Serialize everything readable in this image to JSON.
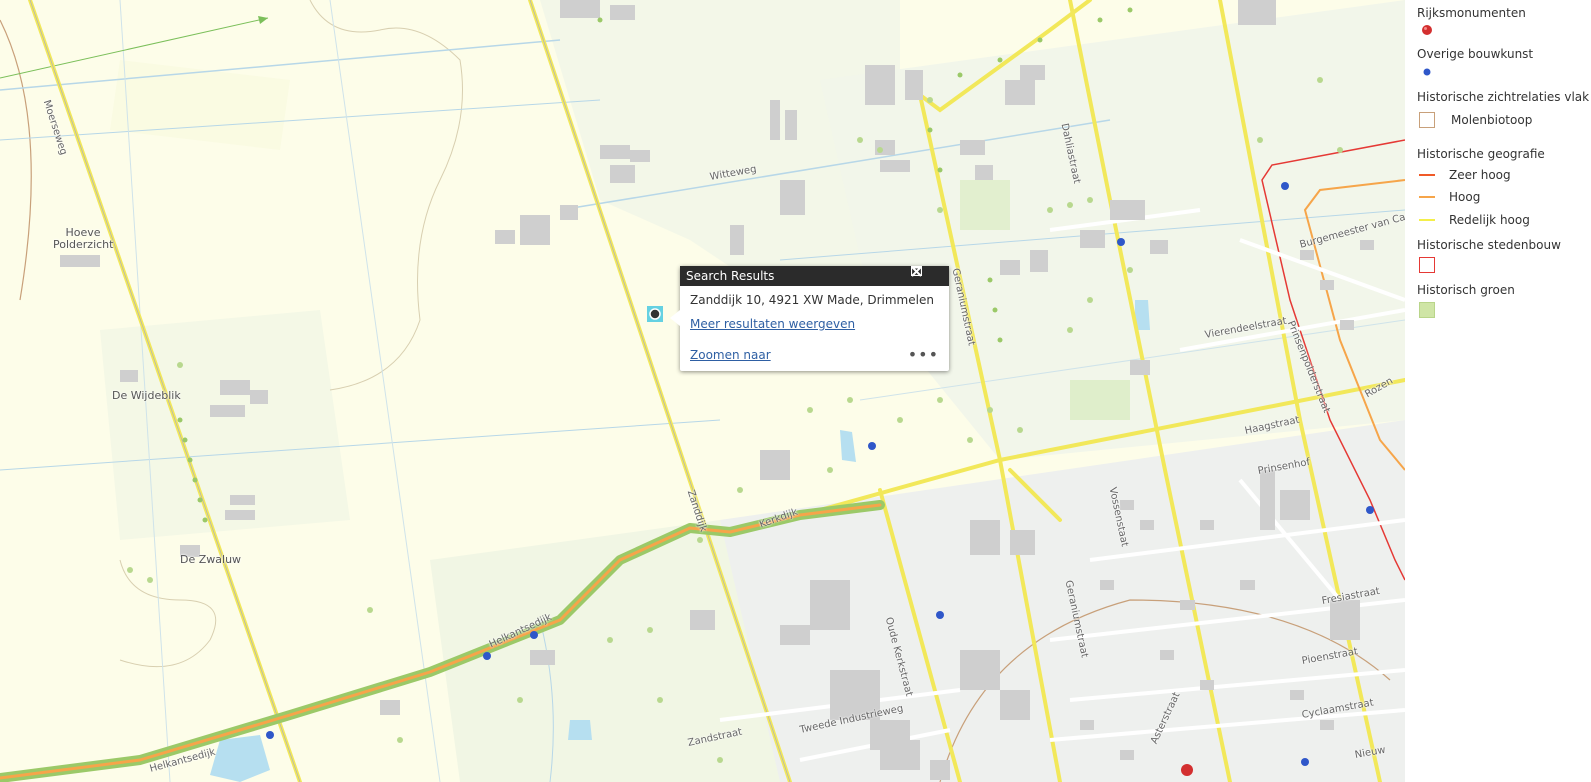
{
  "map": {
    "place_labels": [
      "Hoeve\nPolderzicht",
      "De Wijdeblik",
      "De Zwaluw"
    ],
    "street_labels": [
      "Moerseweg",
      "Witteweg",
      "Dahliastraat",
      "Geraniumstraat",
      "Burgemeester van Ca",
      "Prinsenpolderstraat",
      "Vierendeelstraat",
      "Rozen",
      "Haagstraat",
      "Prinsenhof",
      "Vossenstaat",
      "Geraniumstraat",
      "Fresiastraat",
      "Pioenstraat",
      "Cyclaamstraat",
      "Asterstraat",
      "Nieuw",
      "Zanddijk",
      "Kerkdijk",
      "Helkantsedijk",
      "Helkantsedijk",
      "Oude Kerkstraat",
      "Zandstraat",
      "Tweede Industrieweg"
    ]
  },
  "popup": {
    "title": "Search Results",
    "address": "Zanddijk 10, 4921 XW Made, Drimmelen",
    "more_link": "Meer resultaten weergeven",
    "zoom_link": "Zoomen naar",
    "more_icon": "ellipsis-icon",
    "maximize_icon": "maximize-icon",
    "close_icon": "close-icon"
  },
  "legend": {
    "groups": [
      {
        "title": "Rijksmonumenten",
        "items": [
          {
            "label": "",
            "symbol": "red-dot",
            "color": "#d32f2f"
          }
        ]
      },
      {
        "title": "Overige bouwkunst",
        "items": [
          {
            "label": "",
            "symbol": "blue-dot",
            "color": "#2f57c9"
          }
        ]
      },
      {
        "title": "Historische zichtrelaties vlak",
        "items": [
          {
            "label": "Molenbiotoop",
            "symbol": "box",
            "color": "#c8a07a"
          }
        ]
      },
      {
        "title": "Historische geografie",
        "items": [
          {
            "label": "Zeer hoog",
            "symbol": "line",
            "color": "#f05a28"
          },
          {
            "label": "Hoog",
            "symbol": "line",
            "color": "#f6a54a"
          },
          {
            "label": "Redelijk hoog",
            "symbol": "line",
            "color": "#f4ef4a"
          }
        ]
      },
      {
        "title": "Historische stedenbouw",
        "items": [
          {
            "label": "",
            "symbol": "box",
            "color": "#e53935"
          }
        ]
      },
      {
        "title": "Historisch groen",
        "items": [
          {
            "label": "",
            "symbol": "fill",
            "color": "#cfe5a6"
          }
        ]
      }
    ]
  },
  "colors": {
    "map_background": "#fdfde9",
    "road_yellow": "#f2e85a",
    "road_green": "#8cbf3f",
    "building": "#cfcfcf",
    "popup_header": "#2b2b2b",
    "link": "#2e5fa3"
  }
}
